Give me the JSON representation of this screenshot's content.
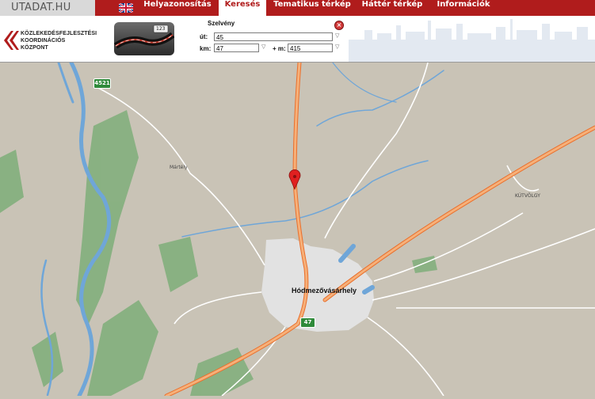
{
  "nav": {
    "site_title": "UTADAT.HU",
    "language_icon": "uk-flag-icon",
    "items": [
      {
        "label": "Helyazonosítás",
        "active": false
      },
      {
        "label": "Keresés",
        "active": true
      },
      {
        "label": "Tematikus térkép",
        "active": false
      },
      {
        "label": "Háttér térkép",
        "active": false
      },
      {
        "label": "Információk",
        "active": false
      }
    ],
    "accent_color": "#b01c1c"
  },
  "header": {
    "logo_lines": [
      "KÖZLEKEDÉSFEJLESZTÉSI",
      "KOORDINÁCIÓS",
      "KÖZPONT"
    ],
    "thumbnail_badge": "123"
  },
  "search_form": {
    "title": "Szelvény",
    "road_label": "út:",
    "road_value": "45",
    "km_label": "km:",
    "km_value": "47",
    "m_label": "+ m:",
    "m_value": "415",
    "close_icon": "close-icon"
  },
  "map": {
    "city": "Hódmezővásárhely",
    "places": [
      "Mártély",
      "KÚTVÖLGY"
    ],
    "road_shields": [
      "4521",
      "47"
    ],
    "marker_icon": "map-pin-icon",
    "colors": {
      "land": "#c9c3b6",
      "river": "#6fa6d8",
      "forest": "#7fae7a",
      "urban": "#e2e2e2",
      "main_road": "#f28c4b",
      "minor_road": "#ffffff"
    }
  }
}
